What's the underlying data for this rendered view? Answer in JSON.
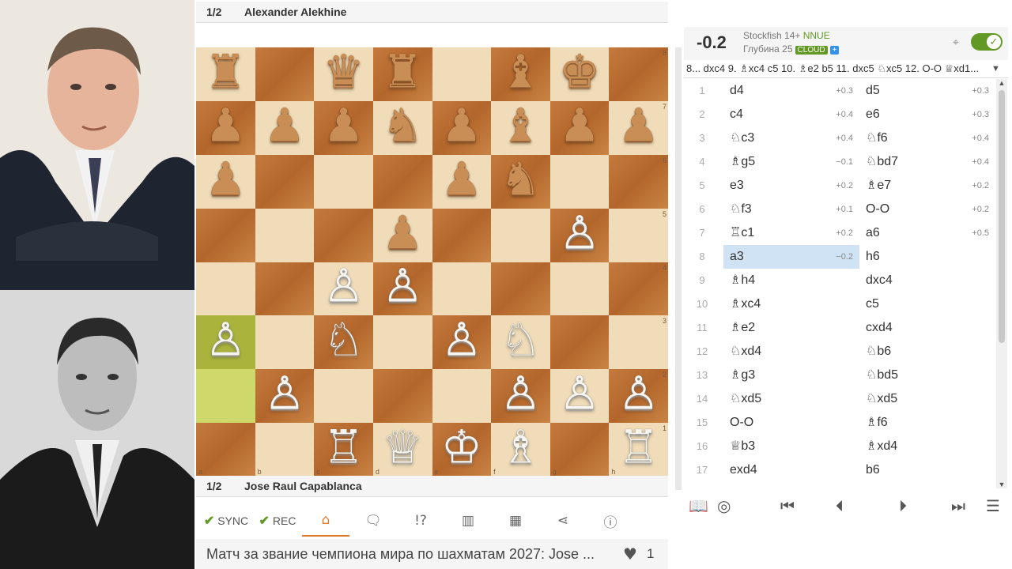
{
  "players": {
    "top": {
      "score": "1/2",
      "name": "Alexander Alekhine"
    },
    "bottom": {
      "score": "1/2",
      "name": "Jose Raul Capablanca"
    }
  },
  "board": {
    "ranks": [
      "8",
      "7",
      "6",
      "5",
      "4",
      "3",
      "2",
      "1"
    ],
    "files": [
      "a",
      "b",
      "c",
      "d",
      "e",
      "f",
      "g",
      "h"
    ],
    "position": [
      [
        "b:♜",
        "",
        "b:♛",
        "b:♜",
        "",
        "b:♝",
        "b:♚",
        ""
      ],
      [
        "b:♟",
        "b:♟",
        "b:♟",
        "b:♞",
        "b:♟",
        "b:♝",
        "b:♟",
        "b:♟"
      ],
      [
        "b:♟",
        "",
        "",
        "",
        "b:♟",
        "b:♞",
        "",
        ""
      ],
      [
        "",
        "",
        "",
        "b:♟",
        "",
        "",
        "w:♙",
        ""
      ],
      [
        "",
        "",
        "w:♙",
        "w:♙",
        "",
        "",
        "",
        ""
      ],
      [
        "w:♙",
        "",
        "w:♘",
        "",
        "w:♙",
        "w:♘",
        "",
        ""
      ],
      [
        "",
        "w:♙",
        "",
        "",
        "",
        "w:♙",
        "w:♙",
        "w:♙"
      ],
      [
        "",
        "",
        "w:♖",
        "w:♕",
        "w:♔",
        "w:♗",
        "",
        "w:♖"
      ]
    ],
    "highlight": [
      [
        5,
        0
      ],
      [
        6,
        0
      ]
    ],
    "colors": {
      "light": "#f0dcb8",
      "dark": "#b3662b",
      "highlight": "#c4cf58"
    }
  },
  "toolbar": {
    "sync_label": "SYNC",
    "rec_label": "REC",
    "icons": [
      "tag-icon",
      "comment-icon",
      "glyph-icon",
      "chart-icon",
      "grid-icon",
      "share-icon",
      "info-icon"
    ]
  },
  "study": {
    "title": "Матч за звание чемпиона мира по шахматам 2027: Jose ...",
    "likes": "1"
  },
  "engine": {
    "score": "-0.2",
    "name": "Stockfish 14+",
    "nnue": "NNUE",
    "depth": "Глубина 25",
    "cloud": "CLOUD",
    "plus": "+",
    "pv": "8... dxc4 9. ♗xc4 c5 10. ♗e2 b5 11. dxc5 ♘xc5 12. O-O ♕xd1..."
  },
  "moves": [
    {
      "n": "1",
      "w": "d4",
      "we": "+0.3",
      "b": "d5",
      "be": "+0.3"
    },
    {
      "n": "2",
      "w": "c4",
      "we": "+0.4",
      "b": "e6",
      "be": "+0.3"
    },
    {
      "n": "3",
      "w": "♘c3",
      "we": "+0.4",
      "b": "♘f6",
      "be": "+0.4"
    },
    {
      "n": "4",
      "w": "♗g5",
      "we": "−0.1",
      "b": "♘bd7",
      "be": "+0.4"
    },
    {
      "n": "5",
      "w": "e3",
      "we": "+0.2",
      "b": "♗e7",
      "be": "+0.2"
    },
    {
      "n": "6",
      "w": "♘f3",
      "we": "+0.1",
      "b": "O-O",
      "be": "+0.2"
    },
    {
      "n": "7",
      "w": "♖c1",
      "we": "+0.2",
      "b": "a6",
      "be": "+0.5"
    },
    {
      "n": "8",
      "w": "a3",
      "we": "−0.2",
      "b": "h6",
      "be": ""
    },
    {
      "n": "9",
      "w": "♗h4",
      "we": "",
      "b": "dxc4",
      "be": ""
    },
    {
      "n": "10",
      "w": "♗xc4",
      "we": "",
      "b": "c5",
      "be": ""
    },
    {
      "n": "11",
      "w": "♗e2",
      "we": "",
      "b": "cxd4",
      "be": ""
    },
    {
      "n": "12",
      "w": "♘xd4",
      "we": "",
      "b": "♘b6",
      "be": ""
    },
    {
      "n": "13",
      "w": "♗g3",
      "we": "",
      "b": "♘bd5",
      "be": ""
    },
    {
      "n": "14",
      "w": "♘xd5",
      "we": "",
      "b": "♘xd5",
      "be": ""
    },
    {
      "n": "15",
      "w": "O-O",
      "we": "",
      "b": "♗f6",
      "be": ""
    },
    {
      "n": "16",
      "w": "♕b3",
      "we": "",
      "b": "♗xd4",
      "be": ""
    },
    {
      "n": "17",
      "w": "exd4",
      "we": "",
      "b": "b6",
      "be": ""
    }
  ],
  "current_move": "8",
  "controls": [
    "book-icon",
    "target-icon",
    "first-icon",
    "prev-icon",
    "next-icon",
    "last-icon",
    "menu-icon"
  ]
}
